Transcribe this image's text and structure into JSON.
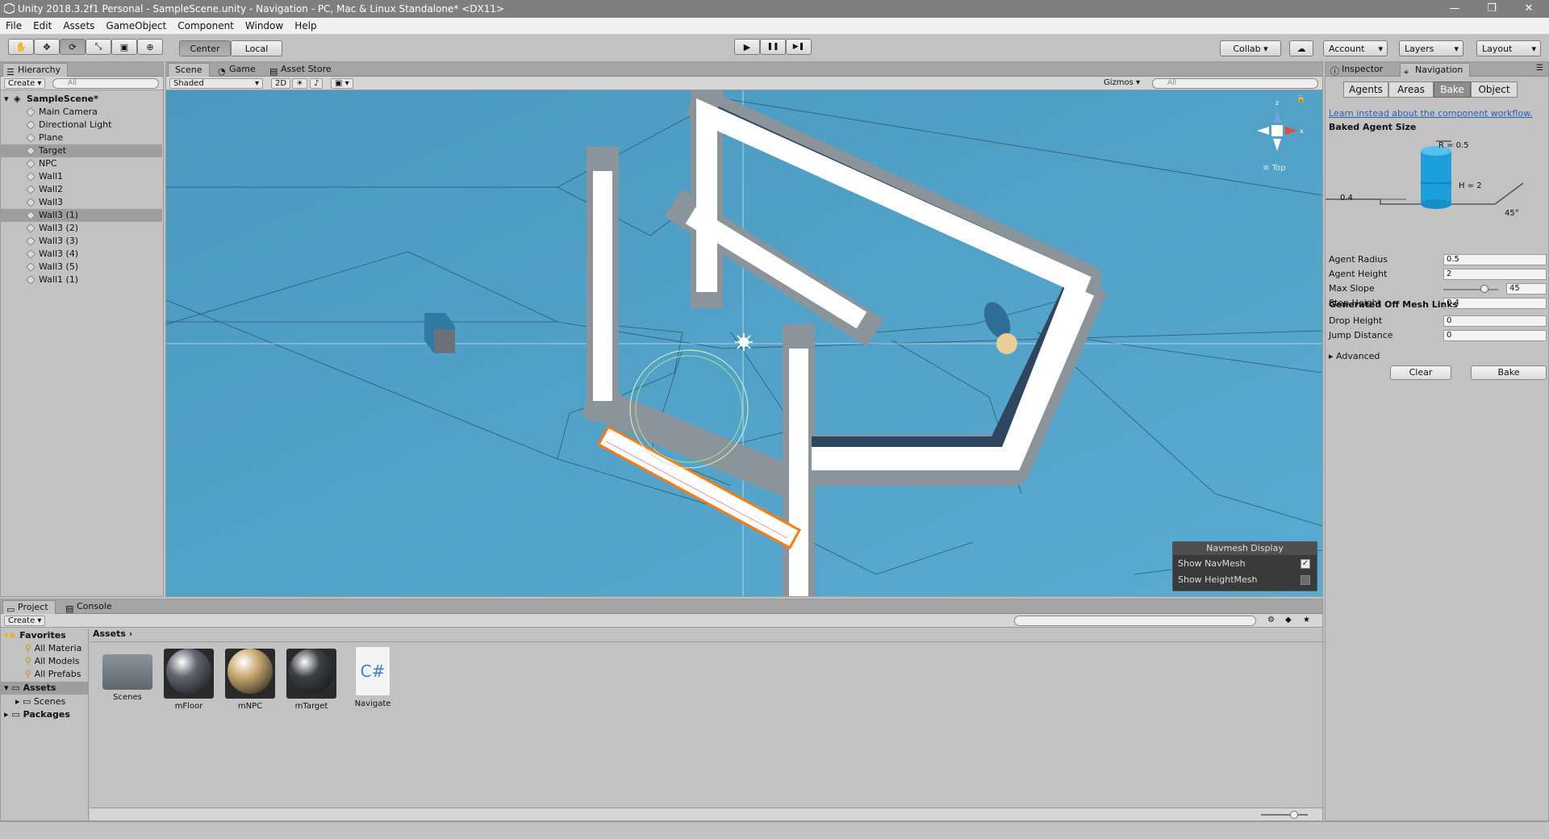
{
  "window": {
    "title": "Unity 2018.3.2f1 Personal - SampleScene.unity - Navigation - PC, Mac & Linux Standalone* <DX11>",
    "minimize": "—",
    "maximize": "❐",
    "close": "✕"
  },
  "menu": [
    "File",
    "Edit",
    "Assets",
    "GameObject",
    "Component",
    "Window",
    "Help"
  ],
  "toolbar": {
    "center": "Center",
    "local": "Local",
    "collab": "Collab",
    "account": "Account",
    "layers": "Layers",
    "layout": "Layout",
    "play": "▶",
    "pause": "❚❚",
    "step": "▶❚"
  },
  "hierarchy": {
    "tab": "Hierarchy",
    "create": "Create",
    "search": "All",
    "scene": "SampleScene*",
    "items": [
      "Main Camera",
      "Directional Light",
      "Plane",
      "Target",
      "NPC",
      "Wall1",
      "Wall2",
      "Wall3",
      "Wall3 (1)",
      "Wall3 (2)",
      "Wall3 (3)",
      "Wall3 (4)",
      "Wall3 (5)",
      "Wall1 (1)"
    ],
    "selected": [
      "Target",
      "Wall3 (1)"
    ]
  },
  "scene": {
    "tabs": [
      "Scene",
      "Game",
      "Asset Store"
    ],
    "shading": "Shaded",
    "mode2d": "2D",
    "gizmos": "Gizmos",
    "search": "All",
    "view_label": "Top",
    "navmesh_display": {
      "title": "Navmesh Display",
      "show_navmesh": "Show NavMesh",
      "show_heightmesh": "Show HeightMesh",
      "navmesh_checked": true,
      "heightmesh_checked": false
    }
  },
  "inspector": {
    "tabs": [
      "Inspector",
      "Navigation"
    ],
    "nav_tabs": [
      "Agents",
      "Areas",
      "Bake",
      "Object"
    ],
    "active_tab": "Bake",
    "link": "Learn instead about the component workflow.",
    "baked_agent_size": "Baked Agent Size",
    "diagram": {
      "radius": "R = 0.5",
      "height": "H = 2",
      "step": "0.4",
      "slope": "45°"
    },
    "fields": [
      {
        "label": "Agent Radius",
        "value": "0.5"
      },
      {
        "label": "Agent Height",
        "value": "2"
      },
      {
        "label": "Max Slope",
        "value": "45",
        "slider": true,
        "fraction": 0.75
      },
      {
        "label": "Step Height",
        "value": "0.4"
      }
    ],
    "offmesh_header": "Generated Off Mesh Links",
    "offmesh": [
      {
        "label": "Drop Height",
        "value": "0"
      },
      {
        "label": "Jump Distance",
        "value": "0"
      }
    ],
    "advanced": "Advanced",
    "clear": "Clear",
    "bake": "Bake"
  },
  "project": {
    "tabs": [
      "Project",
      "Console"
    ],
    "create": "Create",
    "favorites": "Favorites",
    "fav_items": [
      "All Materia",
      "All Models",
      "All Prefabs"
    ],
    "tree": {
      "assets": "Assets",
      "scenes": "Scenes",
      "packages": "Packages"
    },
    "breadcrumb": "Assets",
    "assets": [
      {
        "name": "Scenes",
        "kind": "folder"
      },
      {
        "name": "mFloor",
        "kind": "sphere",
        "color": "#5e6570"
      },
      {
        "name": "mNPC",
        "kind": "sphere",
        "color": "#c9aa70"
      },
      {
        "name": "mTarget",
        "kind": "sphere",
        "color": "#3c3f44"
      },
      {
        "name": "Navigate",
        "kind": "script",
        "glyph": "C#"
      }
    ]
  },
  "colors": {
    "scene_bg": "#4f9fc4",
    "wall": "#ffffff",
    "wall_border": "#8f969c",
    "selected": "#ff7a10"
  }
}
